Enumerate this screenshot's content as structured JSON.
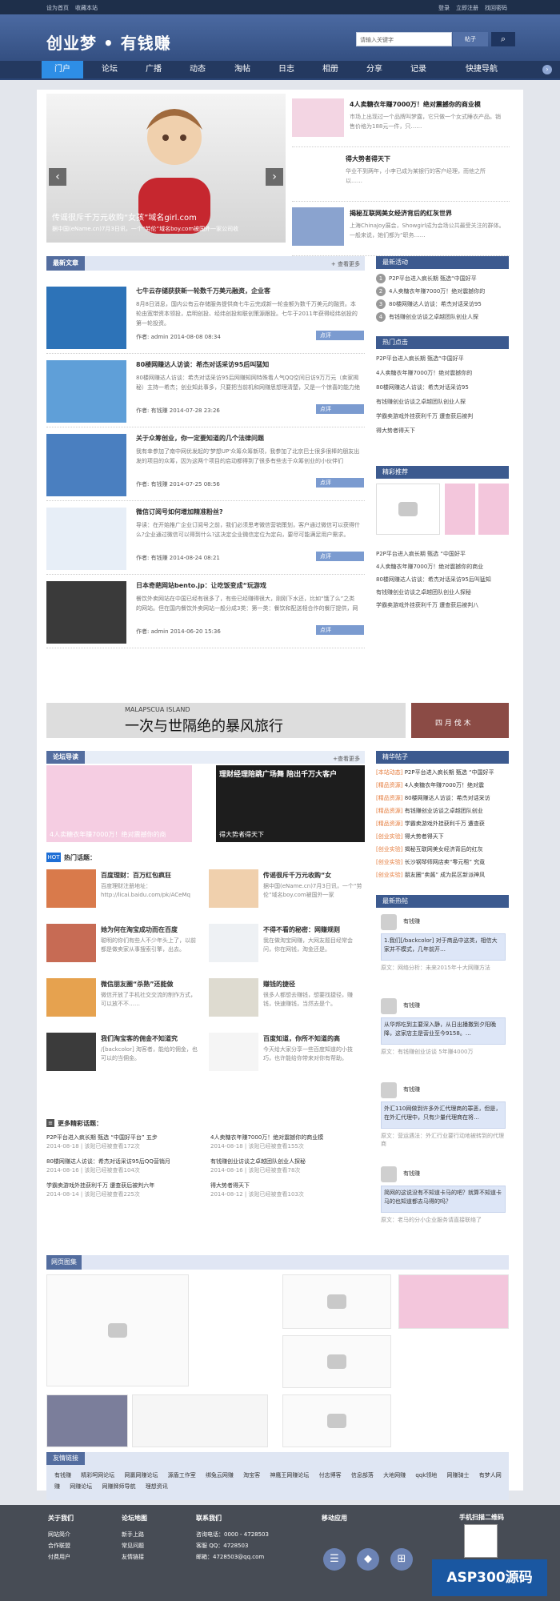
{
  "topbar": {
    "left": [
      "设为首页",
      "收藏本站"
    ],
    "right": [
      "登录",
      "立即注册",
      "找回密码"
    ]
  },
  "header": {
    "logo": "创业梦 • 有钱赚",
    "search_placeholder": "请输入关键字",
    "search_button": "帖子"
  },
  "nav": [
    "门户",
    "论坛",
    "广播",
    "动态",
    "淘帖",
    "日志",
    "相册",
    "分享",
    "记录",
    "快捷导航"
  ],
  "slider": {
    "title": "传谣很斥千万元收购“女孩”域名girl.com",
    "desc": "据中国(eName.cn)7月3日讯，一个“劳伦”域名boy.com被国外一家公司收"
  },
  "top_news": [
    {
      "title": "4人卖糖衣年赚7000万！绝对震撼你的商业模",
      "desc": "市场上出现过一个品牌叫梦露，它只做一个女式睡衣产品。销售价格为188元一件，只……"
    },
    {
      "title": "得大势者得天下",
      "desc": "华业不到两年，小李已成为某银行的客户经理，而他之所以……"
    },
    {
      "title": "揭秘互联网美女经济背后的红灰世界",
      "desc": "上海ChinaJoy展会，Showgirl成为会场公共最受关注的群体。一般来说，她们都为“职务……"
    }
  ],
  "latest": {
    "title": "最新文章",
    "more": "+ 查看更多",
    "items": [
      {
        "title": "七牛云存储获获新一轮数千万美元融资，企业客",
        "desc": "8月8日消息，国内公有云存储服务提供商七牛云完成新一轮金额为数千万美元的融资。本轮由宽带资本领投，启明创投、经纬创投和联创策源跟投。七牛于2011年获得经纬创投的第一轮投资。",
        "meta": "作者: admin  2014-08-08 08:34",
        "like": "点评"
      },
      {
        "title": "80楼网赚达人访谈：希杰对话采访95后叫猛知",
        "desc": "80楼网赚达人访谈：希杰对话采访95后网赚知网特殊看人气QQ空间日访9万万元（卖家揭秘）主持一希杰；创业知此事多，只要把当前机和网赚思想理清楚，又是一个惊喜的能力绝",
        "meta": "作者: 有钱赚  2014-07-28 23:26",
        "like": "点评"
      },
      {
        "title": "关于众筹创业，你一定要知道的几个法律问题",
        "desc": "我有幸参加了南中网优发起的'梦想UP'众筹众筹新项，我参加了北京巴士很多很棒的朋友出发的项目的众筹，因为这两个项目的启动都得到了很多有些志于众筹创业的小伙伴们",
        "meta": "作者: 有钱赚  2014-07-25 08:56",
        "like": "点评"
      },
      {
        "title": "微信订阅号如何增加精准粉丝?",
        "desc": "导读：在开始推广企业订阅号之前，我们必须思考微信营销策划，客户通过微信可以获得什么?企业通过微信可以得到什么?这决定企业微信定位为定向，要尽可能满足用户需求。",
        "meta": "作者: 有钱赚  2014-08-24 08:21",
        "like": "点评"
      },
      {
        "title": "日本奇葩网站bento.jp：让吃饭变成“玩游戏",
        "desc": "餐饮外卖网站在中国已经有很多了，有些已经赚得很大，刚刚下水还，比如“饿了么”之类的网站。但在国内餐饮外卖网站一般分成3类：第一类：餐饮和配送相合作的餐厅提供，网",
        "meta": "作者: admin  2014-06-20 15:36",
        "like": "点评"
      }
    ]
  },
  "activity": {
    "title": "最新活动",
    "items": [
      "P2P平台进入疯长期 甄选“中国好平",
      "4人卖糖衣年赚7000万！绝对震撼你的",
      "80楼网赚达人访谈：希杰对话采访95",
      "有钱赚创业访谈之卓越团队创业人探"
    ]
  },
  "hotpoint": {
    "title": "热门点击",
    "items": [
      "P2P平台进入疯长期 甄选“中国好平",
      "4人卖糖衣年赚7000万！绝对震撼你的",
      "80楼网赚达人访谈：希杰对话采访95",
      "有钱赚创业访谈之卓越团队创业人探",
      "学霸卖游戏外挂获利千万 遭查获后被判",
      "得大势者得天下"
    ]
  },
  "recommend": {
    "title": "精彩推荐",
    "items": [
      "P2P平台进入疯长期 甄选 “中国好平",
      "4人卖糖衣年赚7000万！绝对震撼你的商业",
      "80楼网赚达人访谈：希杰对话采访95后叫猛知",
      "有钱赚创业访谈之卓越团队创业人探秘",
      "学霸卖游戏外挂获利千万 遭查获后被判八"
    ]
  },
  "banner": {
    "caption": "一次与世隔绝的暴风旅行",
    "small": "MALAPSCUA ISLAND",
    "right": "四 月 伐 木"
  },
  "forum": {
    "title": "论坛导读",
    "more": "+查看更多",
    "img1": "4人卖糖衣年赚7000万！绝对震撼你的商",
    "img2": "理财经理陪跳广场舞 陪出千万大客户",
    "img3": "得大势者得天下"
  },
  "hot": {
    "badge": "HOT",
    "label": "热门话题："
  },
  "topics": [
    {
      "title": "百度理财：百万红包疯狂",
      "desc": "百度理财注册地址：http://licai.baidu.com/pk/ACeMq"
    },
    {
      "title": "传谣很斥千万元收购“女",
      "desc": "据中国(eName.cn)7月3日讯，一个“劳伦”域名boy.com被国外一家"
    },
    {
      "title": "她为何在淘宝成功而在百度",
      "desc": "聪明的你们有些人不少年头上了，以前都是做卖家从事搜索引擎，出去。"
    },
    {
      "title": "不得不看的秘密：网赚规则",
      "desc": "我在做淘宝网赚，大网友题目经常会问，你在网钱，淘金还是。"
    },
    {
      "title": "微信朋友圈“杀熟”还能做",
      "desc": "微信开放了手机社交交流的制作方式，可以放不不……"
    },
    {
      "title": "赚钱的捷径",
      "desc": "很多人都想去赚钱，想要找捷径，赚钱，快速赚钱，当然去是个。"
    },
    {
      "title": "我们淘宝客的佣金不知道究",
      "desc": "/[backcolor] 淘客者，能给的佣金，也可以的当佣金。"
    },
    {
      "title": "百度知道，你所不知道的高",
      "desc": "今天给大家分享一些百度知道的小技巧，也许能给你带来对你有帮助。"
    }
  ],
  "moretopics": {
    "title": "更多精彩话题：",
    "items": [
      {
        "title": "P2P平台进入疯长期 甄选 “中国好平台” 五步",
        "meta": "2014-08-18 | 该贴已经被查看172次"
      },
      {
        "title": "4人卖糖衣年赚7000万！绝对震撼你的商业模",
        "meta": "2014-08-18 | 该贴已经被查看155次"
      },
      {
        "title": "80楼网赚达人访谈：希杰对话采访95后QQ营销月",
        "meta": "2014-08-16 | 该贴已经被查看104次"
      },
      {
        "title": "有钱赚创业访谈之卓越团队创业人探秘",
        "meta": "2014-08-16 | 该贴已经被查看78次"
      },
      {
        "title": "学霸卖游戏外挂获利千万 遭查获后被判六年",
        "meta": "2014-08-14 | 该贴已经被查看225次"
      },
      {
        "title": "得大势者得天下",
        "meta": "2014-08-12 | 该贴已经被查看103次"
      }
    ]
  },
  "elite": {
    "title": "精华帖子",
    "items": [
      {
        "tag": "[本站动态]",
        "text": "P2P平台进入疯长期 甄选 “中国好平"
      },
      {
        "tag": "[精品资源]",
        "text": "4人卖糖衣年赚7000万！绝对震"
      },
      {
        "tag": "[精品资源]",
        "text": "80楼网赚达人访谈：希杰对话采访"
      },
      {
        "tag": "[精品资源]",
        "text": "有钱赚创业访谈之卓越团队创业"
      },
      {
        "tag": "[精品资源]",
        "text": "学霸卖游戏外挂获利千万 遭查获"
      },
      {
        "tag": "[创业实验]",
        "text": "得大势者得天下"
      },
      {
        "tag": "[创业实验]",
        "text": "揭秘互联网美女经济背后的红灰"
      },
      {
        "tag": "[创业实验]",
        "text": "长沙钢琴师网店卖“零元租” 究竟"
      },
      {
        "tag": "[创业实验]",
        "text": "朋友圈“卖酱” 成为民区新派神风"
      }
    ]
  },
  "latestreply": {
    "title": "最新热帖",
    "users": [
      {
        "name": "有钱赚",
        "text": "1.我们[/backcolor]    对于商品中这类，相信大家并不模式，几年前开…",
        "source": "原文：网络分析：未来2015年十大网赚方法"
      },
      {
        "name": "有钱赚",
        "text": "从华邦吃到主要深入静，从日出播撒到夕阳晚降，这家店主是营业至今9158。…",
        "source": "原文：有钱赚创业访谈 5年赚4000万"
      },
      {
        "name": "有钱赚",
        "text": "外汇110网做到许多外汇代理商的罪恶，但是，在外汇代理中，只有少量代理商在将…",
        "source": "原文：营运遇法：外汇行业要行动地被转到的代理商"
      },
      {
        "name": "有钱赚",
        "text": "简网的这说没有不知道卡马的吧？就算不知道卡马的也知道都去马得的吗？",
        "source": "原文：老马的分小企业服务请直接联络了"
      }
    ]
  },
  "gallery": {
    "title": "网页图集"
  },
  "links": {
    "title": "友情链接",
    "items": [
      "有钱赚",
      "精彩呵网论坛",
      "网赢网赚论坛",
      "源盾工作室",
      "绑兔云网赚",
      "淘宝客",
      "神鹰王网赚论坛",
      "付志博客",
      "信息部落",
      "大地网赚",
      "qqk领地",
      "网赚骑士",
      "有梦人网赚",
      "网赚论坛",
      "网赚牌师导航",
      "理想资讯"
    ]
  },
  "footer": {
    "about": {
      "title": "关于我们",
      "items": [
        "网站简介",
        "合作联盟",
        "付费用户"
      ]
    },
    "map": {
      "title": "论坛地图",
      "items": [
        "新手上路",
        "常见问题",
        "友情链接"
      ]
    },
    "contact": {
      "title": "联系我们",
      "items": [
        "咨询电话：0000 - 4728503",
        "客服 QQ：4728503",
        "邮箱：4728503@qq.com"
      ]
    },
    "mobile": {
      "title": "移动应用"
    },
    "qr": {
      "title": "手机扫描二维码"
    }
  },
  "brand": "ASP300源码"
}
